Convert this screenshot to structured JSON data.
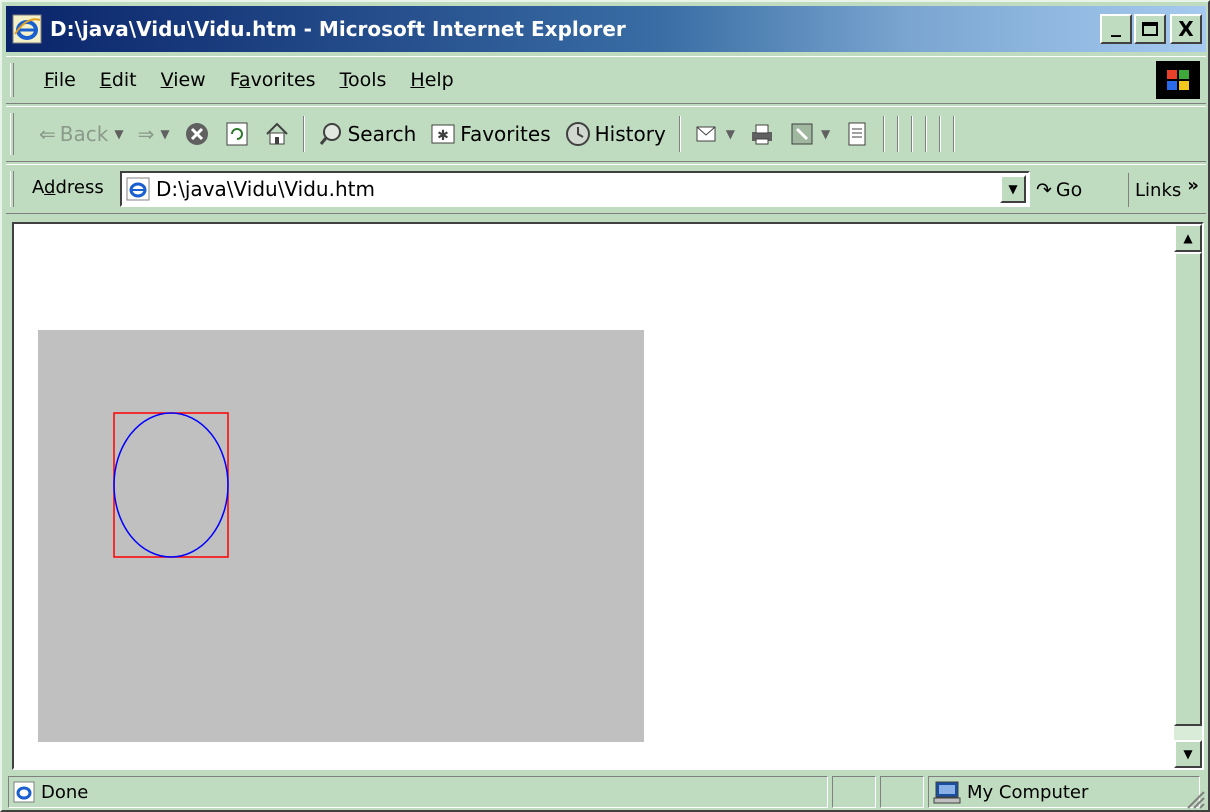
{
  "window": {
    "title": "D:\\java\\Vidu\\Vidu.htm - Microsoft Internet Explorer",
    "minimize": "_",
    "maximize": "□",
    "close": "X"
  },
  "menu": {
    "items": [
      {
        "ul": "F",
        "rest": "ile"
      },
      {
        "ul": "E",
        "rest": "dit"
      },
      {
        "ul": "V",
        "rest": "iew"
      },
      {
        "pre": "F",
        "ul": "a",
        "rest": "vorites"
      },
      {
        "ul": "T",
        "rest": "ools"
      },
      {
        "ul": "H",
        "rest": "elp"
      }
    ]
  },
  "toolbar": {
    "back": "Back",
    "search": "Search",
    "favorites": "Favorites",
    "history": "History"
  },
  "address": {
    "label_pre": "A",
    "label_ul": "d",
    "label_rest": "dress",
    "url": "D:\\java\\Vidu\\Vidu.htm",
    "go": "Go",
    "links": "Links"
  },
  "status": {
    "text": "Done",
    "zone": "My Computer"
  },
  "colors": {
    "applet_bg": "#c0c0c0",
    "rect_stroke": "#ff0000",
    "oval_stroke": "#0000ff"
  }
}
